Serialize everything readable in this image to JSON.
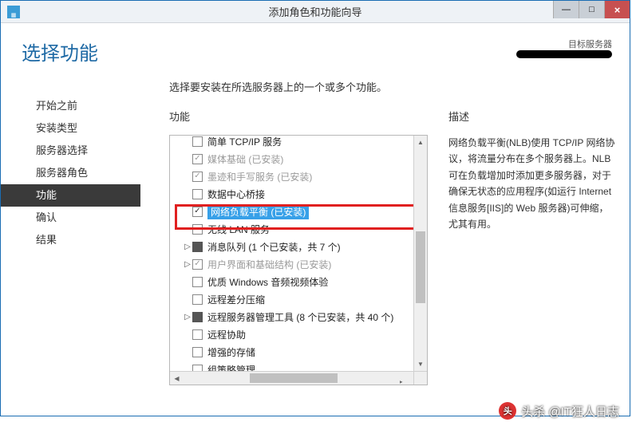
{
  "titlebar": {
    "title": "添加角色和功能向导"
  },
  "header": {
    "page_title": "选择功能",
    "target_label": "目标服务器"
  },
  "sidebar": {
    "items": [
      {
        "label": "开始之前",
        "active": false
      },
      {
        "label": "安装类型",
        "active": false
      },
      {
        "label": "服务器选择",
        "active": false
      },
      {
        "label": "服务器角色",
        "active": false
      },
      {
        "label": "功能",
        "active": true
      },
      {
        "label": "确认",
        "active": false
      },
      {
        "label": "结果",
        "active": false
      }
    ]
  },
  "main": {
    "instruction": "选择要安装在所选服务器上的一个或多个功能。",
    "features_header": "功能",
    "description_header": "描述",
    "description_text": "网络负载平衡(NLB)使用 TCP/IP 网络协议，将流量分布在多个服务器上。NLB 可在负载增加时添加更多服务器，对于确保无状态的应用程序(如运行 Internet 信息服务[IIS]的 Web 服务器)可伸缩，尤其有用。",
    "features": [
      {
        "label": "简单 TCP/IP 服务",
        "checked": false,
        "disabled": false,
        "expander": "",
        "cb": "empty"
      },
      {
        "label": "媒体基础 (已安装)",
        "checked": true,
        "disabled": true,
        "expander": "",
        "cb": "checked"
      },
      {
        "label": "墨迹和手写服务 (已安装)",
        "checked": true,
        "disabled": true,
        "expander": "",
        "cb": "checked"
      },
      {
        "label": "数据中心桥接",
        "checked": false,
        "disabled": false,
        "expander": "",
        "cb": "empty"
      },
      {
        "label": "网络负载平衡 (已安装)",
        "checked": true,
        "disabled": false,
        "expander": "",
        "cb": "checked",
        "highlight": true
      },
      {
        "label": "无线 LAN 服务",
        "checked": false,
        "disabled": false,
        "expander": "",
        "cb": "empty"
      },
      {
        "label": "消息队列 (1 个已安装，共 7 个)",
        "checked": false,
        "disabled": false,
        "expander": "▷",
        "cb": "filled"
      },
      {
        "label": "用户界面和基础结构 (已安装)",
        "checked": true,
        "disabled": true,
        "expander": "▷",
        "cb": "checked"
      },
      {
        "label": "优质 Windows 音频视频体验",
        "checked": false,
        "disabled": false,
        "expander": "",
        "cb": "empty"
      },
      {
        "label": "远程差分压缩",
        "checked": false,
        "disabled": false,
        "expander": "",
        "cb": "empty"
      },
      {
        "label": "远程服务器管理工具 (8 个已安装，共 40 个)",
        "checked": false,
        "disabled": false,
        "expander": "▷",
        "cb": "filled"
      },
      {
        "label": "远程协助",
        "checked": false,
        "disabled": false,
        "expander": "",
        "cb": "empty"
      },
      {
        "label": "增强的存储",
        "checked": false,
        "disabled": false,
        "expander": "",
        "cb": "empty"
      },
      {
        "label": "组策略管理",
        "checked": false,
        "disabled": false,
        "expander": "",
        "cb": "empty"
      }
    ]
  },
  "watermark": "头杀 @IT狂人日志"
}
